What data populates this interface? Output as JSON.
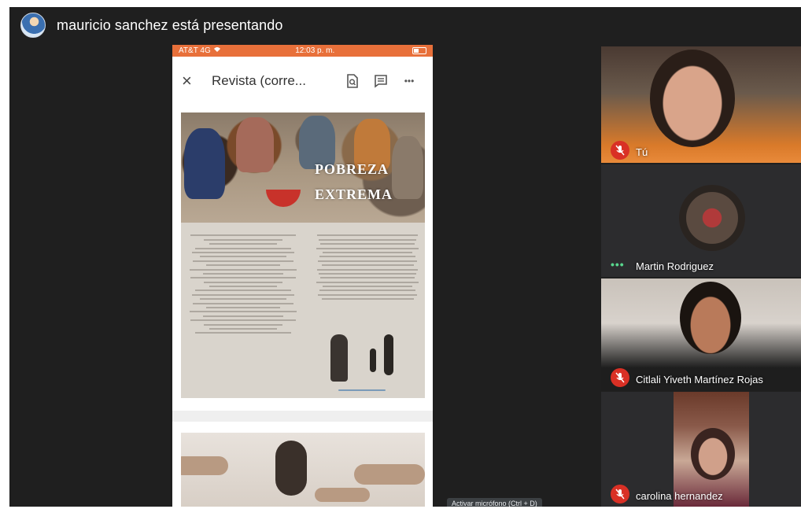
{
  "presenter": {
    "text": "mauricio sanchez está presentando"
  },
  "phone": {
    "status": {
      "carrier": "AT&T 4G",
      "time": "12:03 p. m."
    },
    "app_bar": {
      "title": "Revista (corre...",
      "close_label": "×",
      "more_label": "•••"
    },
    "document": {
      "hero_title_line1": "POBREZA",
      "hero_title_line2": "EXTREMA"
    }
  },
  "participants": [
    {
      "name": "Tú",
      "muted": true
    },
    {
      "name": "Martin Rodriguez",
      "muted": false,
      "speaking_indicator": "•••"
    },
    {
      "name": "Citlali Yiveth Martínez Rojas",
      "muted": true
    },
    {
      "name": "carolina hernandez",
      "muted": true
    }
  ],
  "tooltip": {
    "text": "Activar micrófono (Ctrl + D)"
  },
  "colors": {
    "stage_bg": "#1f1f1f",
    "status_bar": "#e8703a",
    "mic_off": "#d93025",
    "speaking": "#58d68d"
  },
  "icons": [
    "presenter-avatar",
    "wifi-icon",
    "battery-icon",
    "close-icon",
    "search-doc-icon",
    "comment-icon",
    "more-icon",
    "mic-off-icon",
    "speaking-dots-icon"
  ]
}
